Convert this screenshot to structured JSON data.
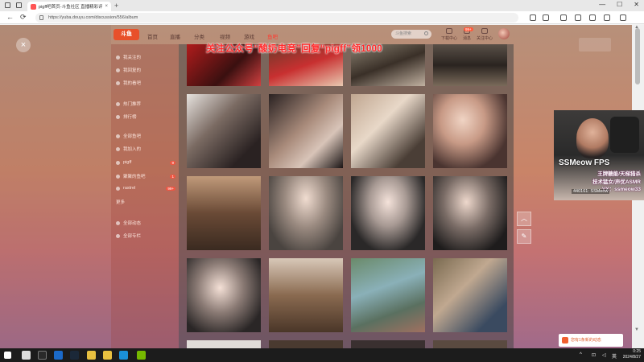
{
  "browser": {
    "tab_title": "pigff吧首页-斗鱼社区 直播精彩评",
    "tab_close": "×",
    "new_tab": "+",
    "url": "https://yuba.douyu.com/discussion/556/album",
    "back": "←",
    "reload": "⟳",
    "window_controls": [
      "—",
      "☐",
      "✕"
    ]
  },
  "site": {
    "logo": "斗鱼",
    "nav": [
      "首页",
      "直播",
      "分类",
      "视频",
      "游戏",
      "鱼吧"
    ],
    "search_placeholder": "斗鱼搜索",
    "header_icons": [
      "下载中心",
      "消息",
      "关注中心"
    ],
    "badge": "99+",
    "promo": "关注公众号“酸奶电竞”回复“pigff”领1000"
  },
  "sidebar": {
    "items": [
      {
        "label": "我关注的"
      },
      {
        "label": "我回复的"
      },
      {
        "label": "我的看吧"
      },
      {
        "label": "热门推荐"
      },
      {
        "label": "排行榜"
      },
      {
        "label": "全部鱼吧"
      },
      {
        "label": "我加入的"
      },
      {
        "label": "pigff",
        "count": "9"
      },
      {
        "label": "聚聚的鱼吧",
        "count": "1"
      },
      {
        "label": "rastrel",
        "count": "99+"
      },
      {
        "label": "更多"
      },
      {
        "label": "全部动态"
      },
      {
        "label": "全部专栏"
      }
    ]
  },
  "cam": {
    "name": "SSMeow FPS",
    "lines": [
      "王牌糖能/天梯猎杀",
      "技术猛女/声优ASMR",
      "VX：ssmeow33"
    ],
    "id": "440161: SSMeow"
  },
  "side_buttons": {
    "top": "︿",
    "edit": "✎"
  },
  "live_bar": "您有1条新的动态",
  "scroll": {
    "up": "▲",
    "down": "▼"
  },
  "taskbar": {
    "time": "0:25",
    "date": "2024/8/27",
    "lang": "英",
    "tray_arrow": "^"
  }
}
